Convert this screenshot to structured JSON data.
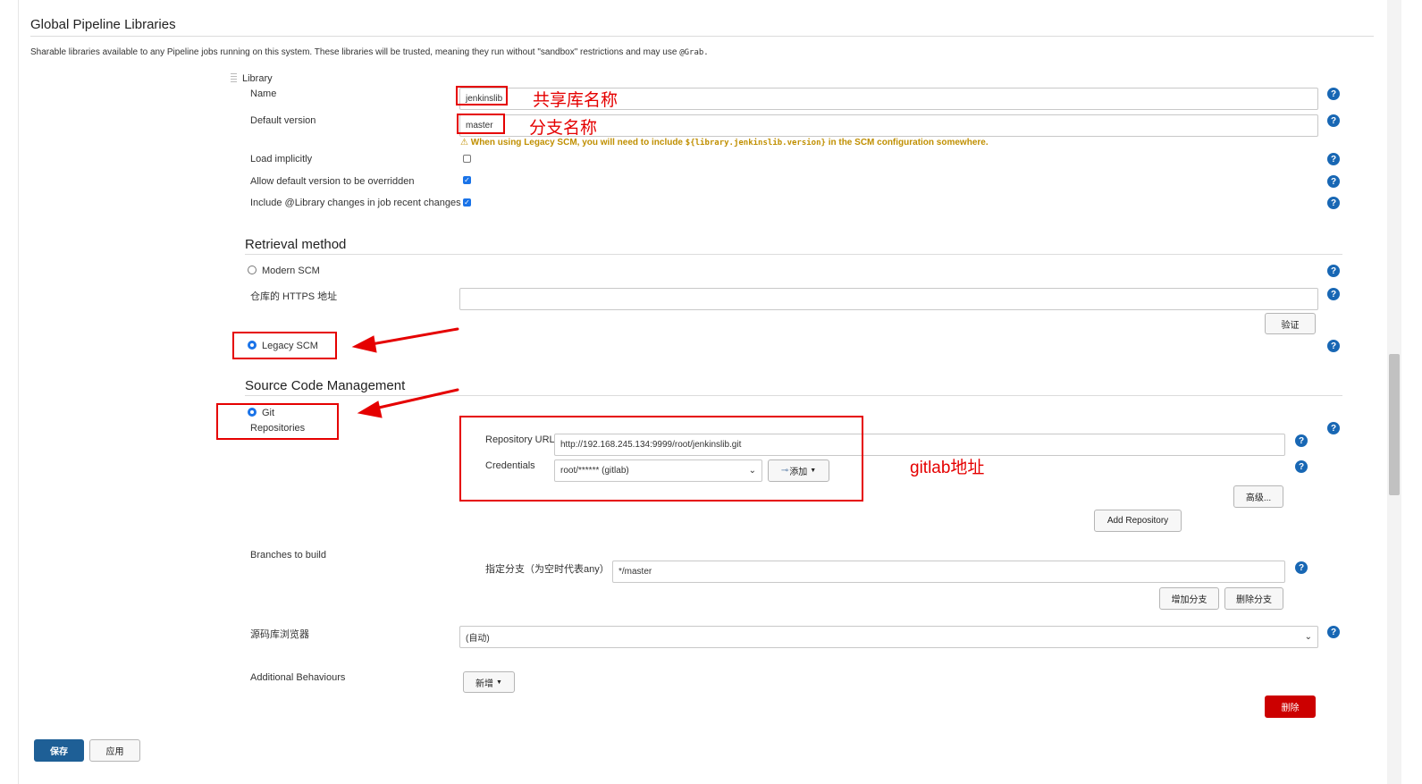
{
  "page": {
    "title": "Global Pipeline Libraries",
    "description": "Sharable libraries available to any Pipeline jobs running on this system. These libraries will be trusted, meaning they run without \"sandbox\" restrictions and may use",
    "description_code": "@Grab."
  },
  "library": {
    "label": "Library",
    "name_label": "Name",
    "name_value": "jenkinslib",
    "default_version_label": "Default version",
    "default_version_value": "master",
    "warning_prefix": "When using Legacy SCM, you will need to include",
    "warning_code": "${library.jenkinslib.version}",
    "warning_suffix": "in the SCM configuration somewhere.",
    "load_implicitly_label": "Load implicitly",
    "load_implicitly": false,
    "allow_override_label": "Allow default version to be overridden",
    "allow_override": true,
    "include_changes_label": "Include @Library changes in job recent changes",
    "include_changes": true
  },
  "retrieval": {
    "heading": "Retrieval method",
    "modern_scm_label": "Modern SCM",
    "https_label": "仓库的 HTTPS 地址",
    "https_value": "",
    "verify_button": "验证",
    "legacy_scm_label": "Legacy SCM",
    "selected": "Legacy SCM"
  },
  "scm": {
    "heading": "Source Code Management",
    "git_label": "Git",
    "repositories_label": "Repositories",
    "repo_url_label": "Repository URL",
    "repo_url_value": "http://192.168.245.134:9999/root/jenkinslib.git",
    "credentials_label": "Credentials",
    "credentials_value": "root/****** (gitlab)",
    "add_credentials_button": "添加",
    "advanced_button": "高级...",
    "add_repository_button": "Add Repository",
    "branches_label": "Branches to build",
    "branch_specifier_label": "指定分支（为空时代表any）",
    "branch_specifier_value": "*/master",
    "add_branch_button": "增加分支",
    "delete_branch_button": "删除分支",
    "browser_label": "源码库浏览器",
    "browser_value": "(自动)",
    "additional_label": "Additional Behaviours",
    "additional_button": "新增"
  },
  "actions": {
    "delete_button": "删除",
    "save_button": "保存",
    "apply_button": "应用"
  },
  "annotations": {
    "name_note": "共享库名称",
    "version_note": "分支名称",
    "gitlab_note": "gitlab地址"
  },
  "colors": {
    "annotation": "#e50000",
    "primary": "#1e5f96",
    "danger": "#cc0000",
    "warning": "#c08f00",
    "help": "#1867b4"
  },
  "icons": [
    "help-icon",
    "warning-icon",
    "chevron-down-icon",
    "key-icon",
    "drag-handle-icon"
  ]
}
